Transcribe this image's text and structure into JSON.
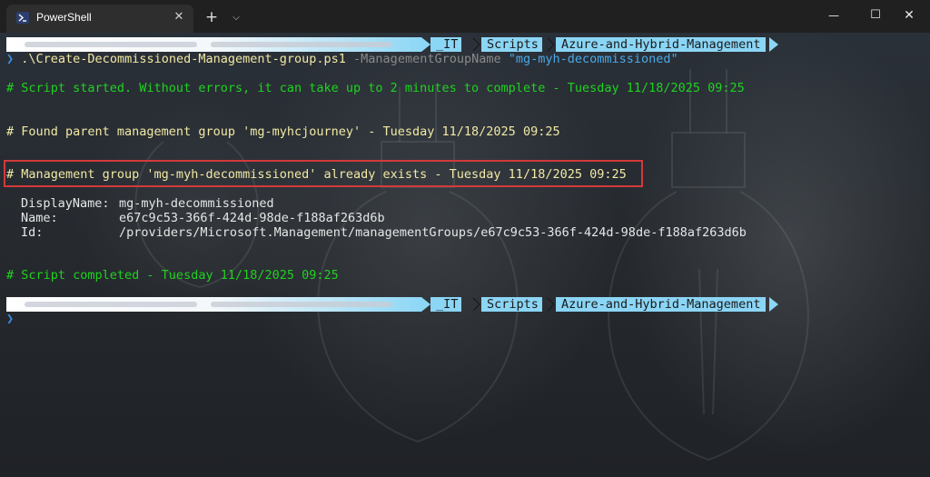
{
  "window": {
    "tab_title": "PowerShell",
    "tab_close": "✕",
    "new_tab": "+",
    "tab_menu": "⌵",
    "minimize": "—",
    "maximize": "☐",
    "close": "✕"
  },
  "prompt": {
    "segments": [
      "_IT",
      "Scripts",
      "Azure-and-Hybrid-Management"
    ],
    "caret": "❯"
  },
  "command": {
    "caret": "❯",
    "script": ".\\Create-Decommissioned-Management-group.ps1",
    "param": "-ManagementGroupName",
    "value": "\"mg-myh-decommissioned\""
  },
  "output": {
    "started": "# Script started. Without errors, it can take up to 2 minutes to complete - Tuesday 11/18/2025 09:25",
    "found_parent": "# Found parent management group 'mg-myhcjourney' - Tuesday 11/18/2025 09:25",
    "already_exists": "# Management group 'mg-myh-decommissioned' already exists - Tuesday 11/18/2025 09:25",
    "properties": [
      {
        "label": "DisplayName:",
        "value": "mg-myh-decommissioned"
      },
      {
        "label": "Name:",
        "value": "e67c9c53-366f-424d-98de-f188af263d6b"
      },
      {
        "label": "Id:",
        "value": "/providers/Microsoft.Management/managementGroups/e67c9c53-366f-424d-98de-f188af263d6b"
      }
    ],
    "completed": "# Script completed - Tuesday 11/18/2025 09:25"
  },
  "colors": {
    "green": "#1ed31e",
    "yellow": "#f2e9a4",
    "blue": "#49a9e8",
    "prompt_segment": "#8bd5f5",
    "highlight": "#d23a3a"
  }
}
